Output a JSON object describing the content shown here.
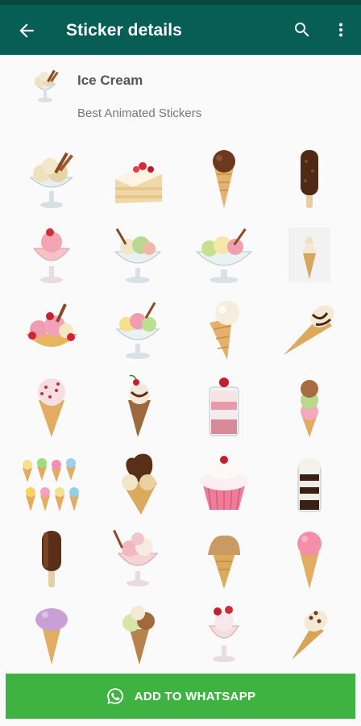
{
  "appbar": {
    "title": "Sticker details",
    "icons": [
      "back-arrow-icon",
      "search-icon",
      "more-vert-icon"
    ],
    "color": "#075e54"
  },
  "pack": {
    "name": "Ice Cream",
    "publisher": "Best Animated Stickers"
  },
  "stickers": [
    "sundae-glass",
    "cake-slice",
    "chocolate-cone",
    "chocolate-popsicle",
    "strawberry-sundae",
    "pistachio-sundae",
    "mixed-sundae-bowl",
    "soft-serve-cone",
    "fruit-sundae-cup",
    "rainbow-sundae",
    "vanilla-cone",
    "chocolate-drizzle-cone",
    "sprinkle-cone",
    "cherry-cone",
    "parfait-glass",
    "triple-scoop-cone",
    "many-cones",
    "chocolate-heart-cone",
    "cupcake",
    "cookies-cream-cup",
    "choc-bar",
    "berry-sundae-glass",
    "caramel-cone",
    "pink-cone",
    "purple-cone",
    "double-scoop-cone",
    "strawberry-parfait",
    "nut-cone"
  ],
  "add_button": {
    "label": "ADD TO WHATSAPP",
    "color": "#3fb342"
  }
}
